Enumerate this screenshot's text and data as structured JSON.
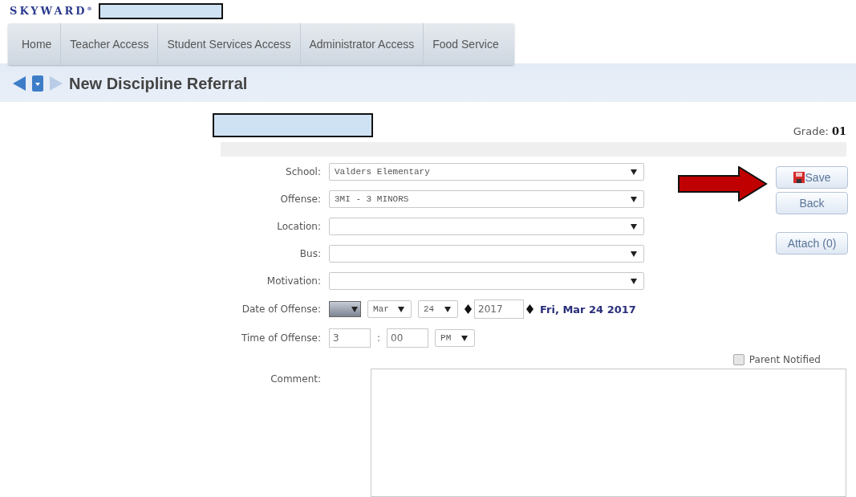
{
  "logo": "SKYWARD$^{®}$",
  "nav": [
    {
      "label": "Home"
    },
    {
      "label": "Teacher Access"
    },
    {
      "label": "Student Services Access"
    },
    {
      "label": "Administrator Access"
    },
    {
      "label": "Food Service"
    }
  ],
  "page_title": "New Discipline Referral",
  "grade": {
    "label": "Grade:",
    "value": "01"
  },
  "fields": [
    {
      "kind": "select",
      "label": "School:",
      "value": "Valders Elementary"
    },
    {
      "kind": "select",
      "label": "Offense:",
      "value": "3MI - 3 MINORS"
    },
    {
      "kind": "select",
      "label": "Location:"
    },
    {
      "kind": "select",
      "label": "Bus:"
    },
    {
      "kind": "select",
      "label": "Motivation:"
    }
  ],
  "date_of_offense": {
    "label": "Date of Offense:",
    "month": "Mar",
    "day": "24",
    "year": "2017",
    "full_date": "Fri, Mar 24 2017"
  },
  "time_of_offense": {
    "label": "Time of Offense:",
    "hour": "3",
    "separator": ":",
    "minute": "00",
    "period": "PM"
  },
  "parent_notified": {
    "label": "Parent Notified",
    "checked": false
  },
  "comment": {
    "label": "Comment:"
  },
  "buttons": [
    {
      "kind": "save",
      "label": "Save"
    },
    {
      "kind": "plain",
      "label": "Back"
    },
    {
      "kind": "plain",
      "label": "Attach (0)"
    }
  ]
}
